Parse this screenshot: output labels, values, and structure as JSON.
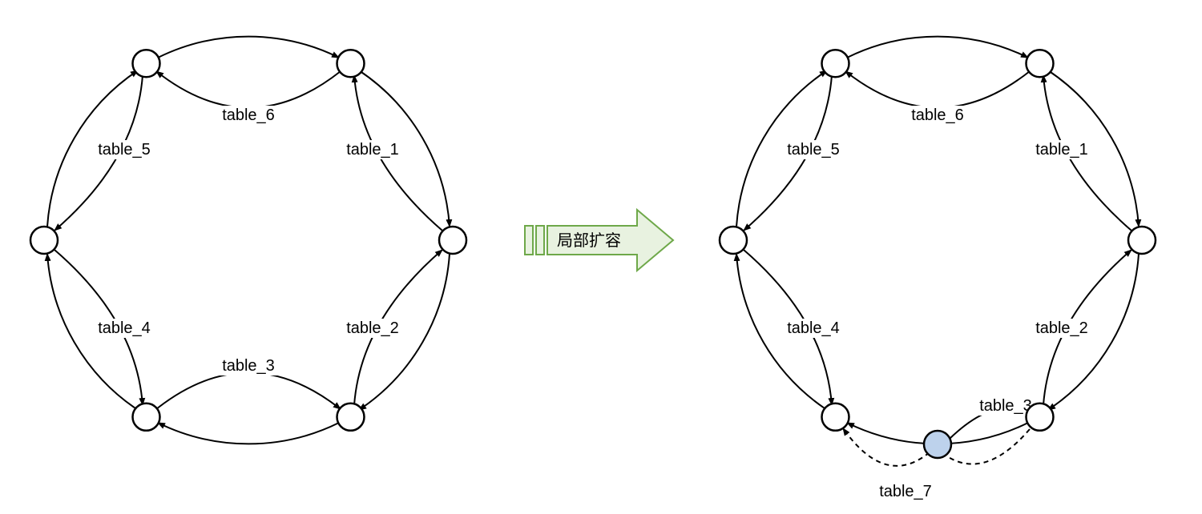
{
  "transition": {
    "label": "局部扩容"
  },
  "left_ring": {
    "edges": [
      {
        "id": "e1",
        "label": "table_1"
      },
      {
        "id": "e2",
        "label": "table_2"
      },
      {
        "id": "e3",
        "label": "table_3"
      },
      {
        "id": "e4",
        "label": "table_4"
      },
      {
        "id": "e5",
        "label": "table_5"
      },
      {
        "id": "e6",
        "label": "table_6"
      }
    ],
    "node_count": 6
  },
  "right_ring": {
    "edges": [
      {
        "id": "e1",
        "label": "table_1"
      },
      {
        "id": "e2",
        "label": "table_2"
      },
      {
        "id": "e3",
        "label": "table_3"
      },
      {
        "id": "e4",
        "label": "table_4"
      },
      {
        "id": "e5",
        "label": "table_5"
      },
      {
        "id": "e6",
        "label": "table_6"
      },
      {
        "id": "e7",
        "label": "table_7",
        "new": true
      }
    ],
    "node_count": 7,
    "new_node_color": "#bdd2ec"
  }
}
